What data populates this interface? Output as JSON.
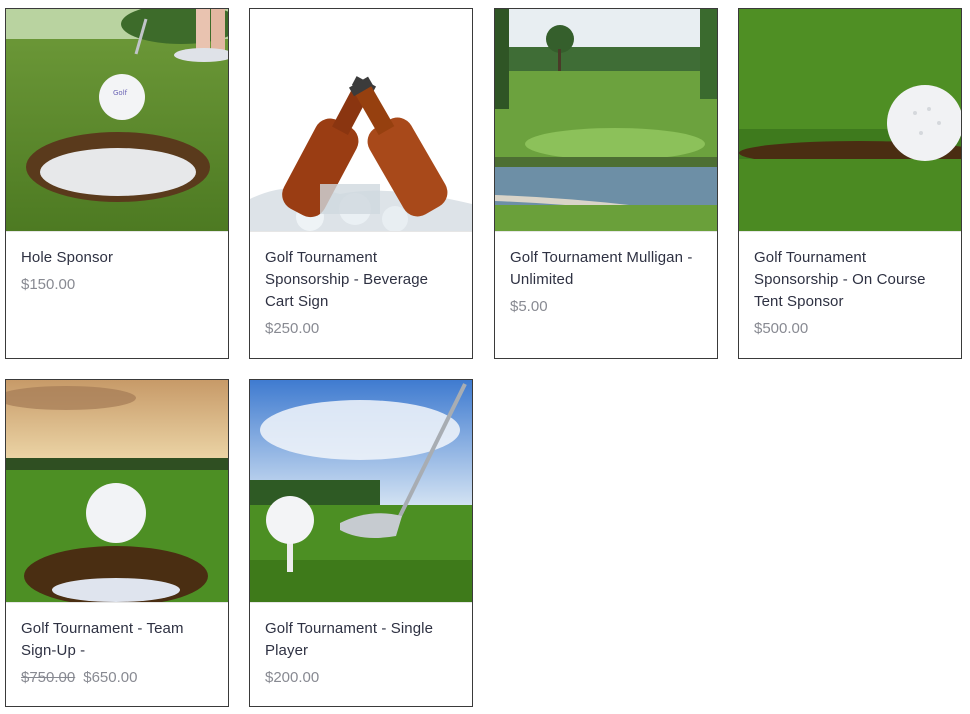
{
  "products": [
    {
      "title": "Hole Sponsor",
      "price": "$150.00",
      "image": "golf-ball-near-hole"
    },
    {
      "title": "Golf Tournament Sponsorship - Beverage Cart Sign",
      "price": "$250.00",
      "image": "beer-bottles-on-ice"
    },
    {
      "title": "Golf Tournament Mulligan -Unlimited",
      "price": "$5.00",
      "image": "golf-course-with-pond"
    },
    {
      "title": "Golf Tournament Sponsorship - On Course Tent Sponsor",
      "price": "$500.00",
      "image": "golf-ball-on-green"
    },
    {
      "title": "Golf Tournament - Team Sign-Up -",
      "old_price": "$750.00",
      "price": "$650.00",
      "image": "golf-ball-on-hole-sunset"
    },
    {
      "title": "Golf Tournament - Single Player",
      "price": "$200.00",
      "image": "golf-club-and-tee"
    }
  ]
}
